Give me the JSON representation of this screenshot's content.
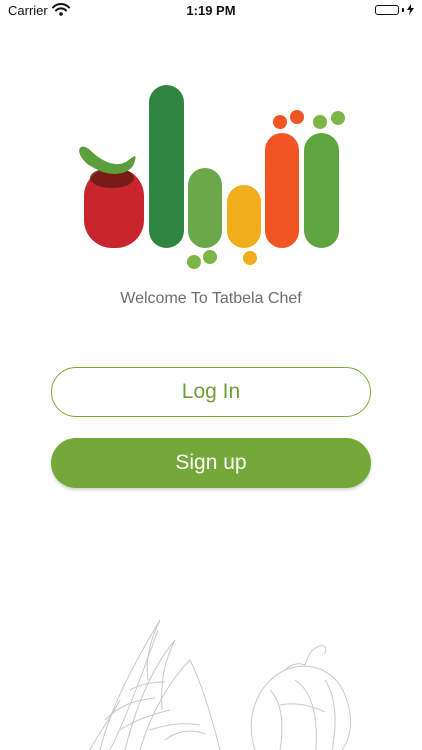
{
  "status_bar": {
    "carrier": "Carrier",
    "time": "1:19 PM",
    "battery_level": 1.0,
    "battery_color": "#4cd964",
    "wifi_icon": "wifi-icon",
    "charging_icon": "bolt-icon"
  },
  "logo": {
    "icon": "tatbela-vegetables-logo"
  },
  "welcome_text": "Welcome To Tatbela Chef",
  "buttons": {
    "login_label": "Log In",
    "signup_label": "Sign up"
  },
  "colors": {
    "accent": "#74a93a",
    "text_muted": "#6d6d6d"
  },
  "decoration": {
    "icon": "vegetables-sketch"
  }
}
